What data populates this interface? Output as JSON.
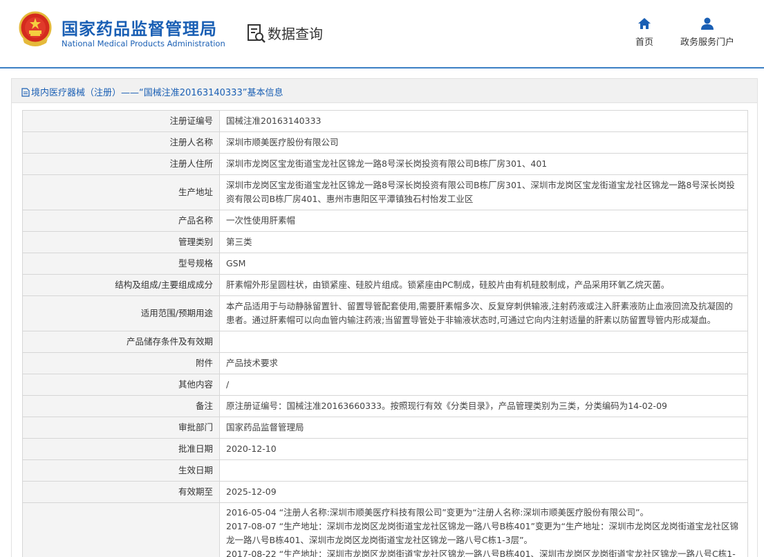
{
  "header": {
    "site_title_cn": "国家药品监督管理局",
    "site_title_en": "National Medical Products Administration",
    "section_label": "数据查询",
    "nav": {
      "home": "首页",
      "portal": "政务服务门户"
    },
    "brand_color": "#1a5fb4"
  },
  "panel": {
    "title": "境内医疗器械（注册）——“国械注准20163140333”基本信息"
  },
  "table": {
    "rows": [
      {
        "label": "注册证编号",
        "value": "国械注准20163140333"
      },
      {
        "label": "注册人名称",
        "value": "深圳市顺美医疗股份有限公司"
      },
      {
        "label": "注册人住所",
        "value": "深圳市龙岗区宝龙街道宝龙社区锦龙一路8号深长岗投资有限公司B栋厂房301、401"
      },
      {
        "label": "生产地址",
        "value": "深圳市龙岗区宝龙街道宝龙社区锦龙一路8号深长岗投资有限公司B栋厂房301、深圳市龙岗区宝龙街道宝龙社区锦龙一路8号深长岗投资有限公司B栋厂房401、惠州市惠阳区平潭镇独石村怡发工业区"
      },
      {
        "label": "产品名称",
        "value": "一次性使用肝素帽"
      },
      {
        "label": "管理类别",
        "value": "第三类"
      },
      {
        "label": "型号规格",
        "value": "GSM"
      },
      {
        "label": "结构及组成/主要组成成分",
        "value": "肝素帽外形呈圆柱状，由锁紧座、硅胶片组成。锁紧座由PC制成，硅胶片由有机硅胶制成，产品采用环氧乙烷灭菌。"
      },
      {
        "label": "适用范围/预期用途",
        "value": "本产品适用于与动静脉留置针、留置导管配套使用,需要肝素帽多次、反复穿刺供输液,注射药液或注入肝素液防止血液回流及抗凝固的患者。通过肝素帽可以向血管内输注药液;当留置导管处于非输液状态时,可通过它向内注射适量的肝素以防留置导管内形成凝血。"
      },
      {
        "label": "产品储存条件及有效期",
        "value": ""
      },
      {
        "label": "附件",
        "value": "产品技术要求"
      },
      {
        "label": "其他内容",
        "value": "/"
      },
      {
        "label": "备注",
        "value": "原注册证编号：国械注准20163660333。按照现行有效《分类目录》，产品管理类别为三类，分类编码为14-02-09"
      },
      {
        "label": "审批部门",
        "value": "国家药品监督管理局"
      },
      {
        "label": "批准日期",
        "value": "2020-12-10"
      },
      {
        "label": "生效日期",
        "value": ""
      },
      {
        "label": "有效期至",
        "value": "2025-12-09"
      }
    ],
    "change_history_lines": [
      "2016-05-04 “注册人名称:深圳市顺美医疗科技有限公司”变更为“注册人名称:深圳市顺美医疗股份有限公司”。",
      "2017-08-07 “生产地址：深圳市龙岗区龙岗街道宝龙社区锦龙一路八号B栋401”变更为“生产地址：深圳市龙岗区龙岗街道宝龙社区锦龙一路八号B栋401、深圳市龙岗区龙岗街道宝龙社区锦龙一路八号C栋1-3层”。",
      "2017-08-22 “生产地址：深圳市龙岗区龙岗街道宝龙社区锦龙一路八号B栋401、深圳市龙岗区龙岗街道宝龙社区锦龙一路八号C栋1-"
    ]
  }
}
